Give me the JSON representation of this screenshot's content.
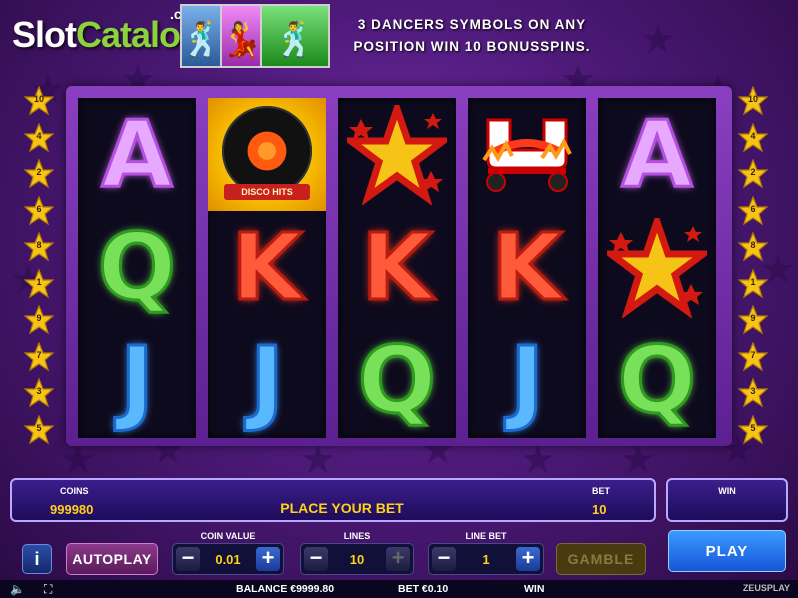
{
  "logo": {
    "slot": "Slot",
    "catalog": "Catalog",
    "com": ".com"
  },
  "hint": "3 DANCERS SYMBOLS ON ANY POSITION WIN 10 BONUSSPINS.",
  "thumbs": [
    {
      "name": "blue-dancer",
      "color": "#4a8acc"
    },
    {
      "name": "pink-dancer",
      "color": "#d04ae0"
    },
    {
      "name": "green-dancer",
      "color": "#3ab83a"
    }
  ],
  "paylines_left": [
    "10",
    "4",
    "2",
    "6",
    "8",
    "1",
    "9",
    "7",
    "3",
    "5"
  ],
  "paylines_right": [
    "10",
    "4",
    "2",
    "6",
    "8",
    "1",
    "9",
    "7",
    "3",
    "5"
  ],
  "reels": [
    [
      "A",
      "Q",
      "J"
    ],
    [
      "DISCO",
      "K",
      "J"
    ],
    [
      "STAR",
      "K",
      "Q"
    ],
    [
      "SKATE",
      "K",
      "J"
    ],
    [
      "A",
      "STAR",
      "Q"
    ]
  ],
  "disco_label": "DISCO HITS",
  "info": {
    "coins_label": "COINS",
    "coins_value": "999980",
    "message": "PLACE YOUR BET",
    "bet_label": "BET",
    "bet_value": "10",
    "win_label": "WIN"
  },
  "controls": {
    "info": "i",
    "autoplay": "AUTOPLAY",
    "coin_value_label": "COIN VALUE",
    "coin_value": "0.01",
    "lines_label": "LINES",
    "lines": "10",
    "line_bet_label": "LINE BET",
    "line_bet": "1",
    "gamble": "GAMBLE",
    "play": "PLAY"
  },
  "footer": {
    "balance": "BALANCE €9999.80",
    "bet": "BET €0.10",
    "win": "WIN",
    "brand": "ZEUSPLAY"
  },
  "colors": {
    "accent": "#ffd21a",
    "play": "#1656d8",
    "frame": "#8a3fc0"
  }
}
